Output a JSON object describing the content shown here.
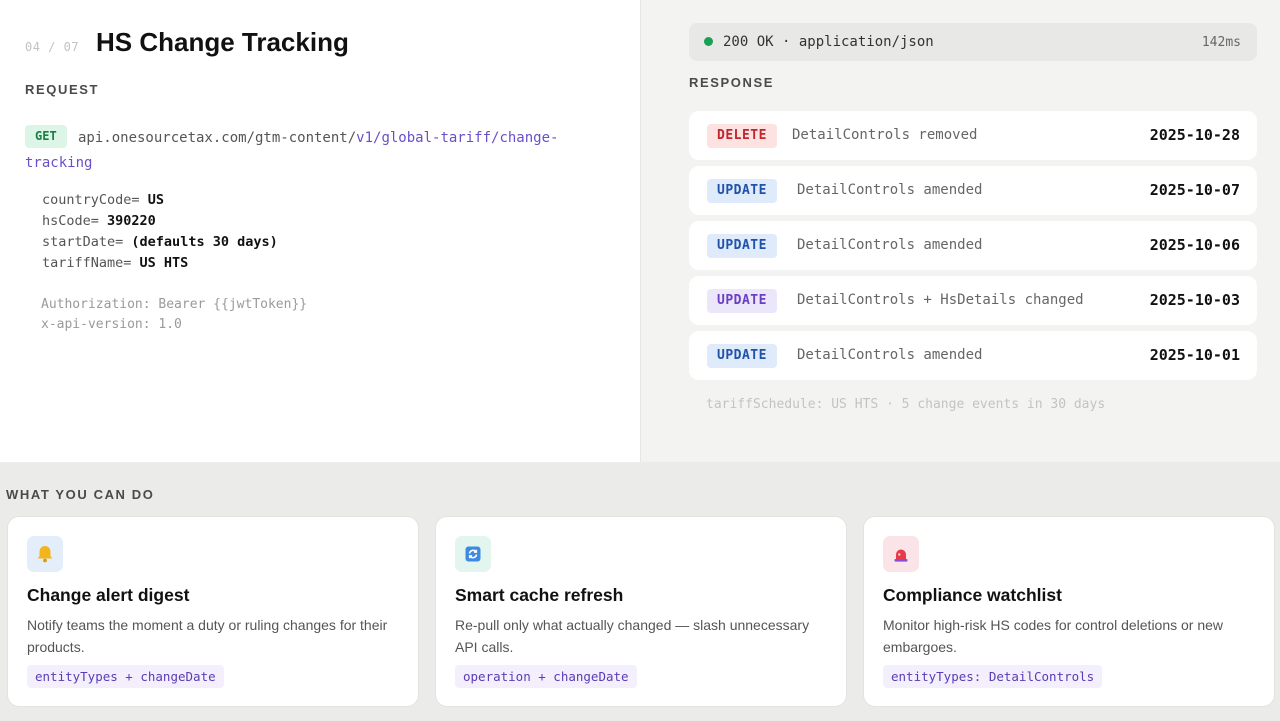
{
  "header": {
    "step": "04 / 07",
    "title": "HS Change Tracking"
  },
  "request": {
    "label": "REQUEST",
    "method": "GET",
    "url_host": "api.onesourcetax.com/gtm-content/",
    "url_path": "v1/global-tariff/change-tracking",
    "params": [
      {
        "key": "countryCode=",
        "value": "US"
      },
      {
        "key": "hsCode=",
        "value": "390220"
      },
      {
        "key": "startDate=",
        "value": "(defaults 30 days)"
      },
      {
        "key": "tariffName=",
        "value": "US HTS"
      }
    ],
    "headers": [
      "Authorization: Bearer {{jwtToken}}",
      "x-api-version: 1.0"
    ]
  },
  "response": {
    "status": "200 OK · application/json",
    "time": "142ms",
    "label": "RESPONSE",
    "events": [
      {
        "op": "DELETE",
        "desc": "DetailControls removed",
        "date": "2025-10-28"
      },
      {
        "op": "UPDATE",
        "desc": "DetailControls amended",
        "date": "2025-10-07"
      },
      {
        "op": "UPDATE",
        "desc": "DetailControls amended",
        "date": "2025-10-06"
      },
      {
        "op": "UPDATE",
        "desc": "DetailControls + HsDetails changed",
        "date": "2025-10-03"
      },
      {
        "op": "UPDATE",
        "desc": "DetailControls amended",
        "date": "2025-10-01"
      }
    ],
    "summary": "tariffSchedule: US HTS · 5 change events in 30 days"
  },
  "features": {
    "label": "WHAT YOU CAN DO",
    "cards": [
      {
        "icon": "bell-icon",
        "title": "Change alert digest",
        "desc": "Notify teams the moment a duty or ruling changes for their products.",
        "chip": "entityTypes + changeDate"
      },
      {
        "icon": "refresh-icon",
        "title": "Smart cache refresh",
        "desc": "Re-pull only what actually changed — slash unnecessary API calls.",
        "chip": "operation + changeDate"
      },
      {
        "icon": "siren-icon",
        "title": "Compliance watchlist",
        "desc": "Monitor high-risk HS codes for control deletions or new embargoes.",
        "chip": "entityTypes: DetailControls"
      }
    ]
  },
  "colors": {
    "get_badge": "#1a7f45",
    "delete_badge": "#c0262d",
    "update_badge": "#1f52a8",
    "status_ok": "#1aa055",
    "chip_text": "#5a3cb4"
  }
}
